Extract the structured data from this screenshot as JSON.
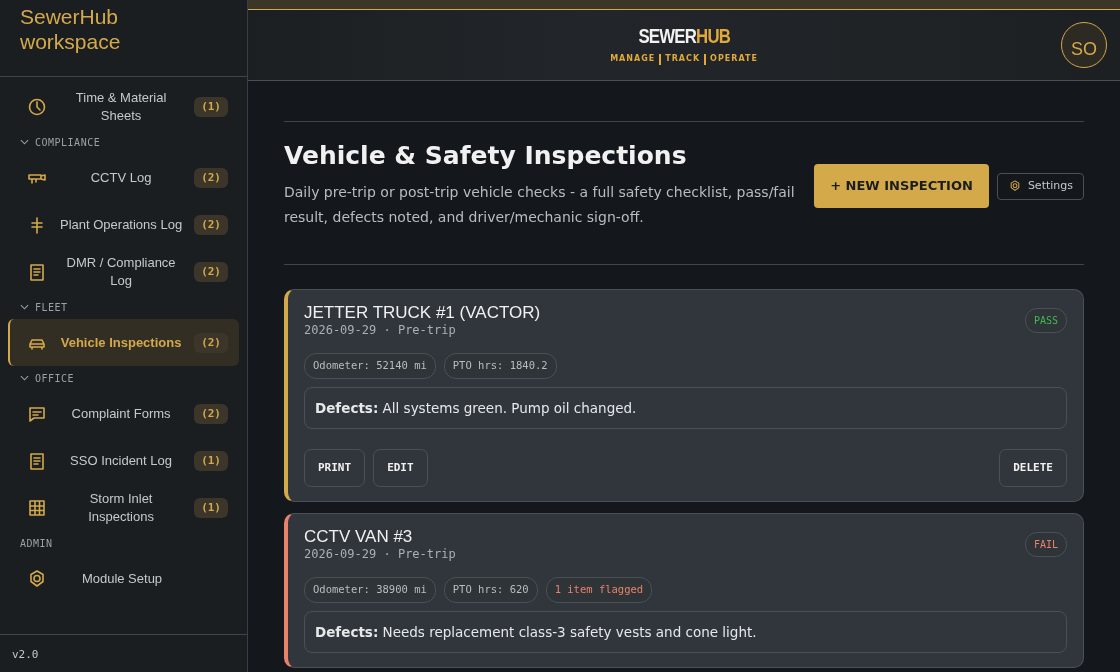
{
  "sidebar": {
    "brand": "SewerHub workspace",
    "sections": [
      {
        "items": [
          {
            "kind": "clock",
            "label": "Time & Material Sheets",
            "count": "(1)",
            "selected": false
          }
        ]
      },
      {
        "heading": "COMPLIANCE",
        "collapsible": true,
        "items": [
          {
            "kind": "camera",
            "label": "CCTV Log",
            "count": "(2)",
            "selected": false
          },
          {
            "kind": "valve",
            "label": "Plant Operations Log",
            "count": "(2)",
            "selected": false
          },
          {
            "kind": "document",
            "label": "DMR / Compliance Log",
            "count": "(2)",
            "selected": false
          }
        ]
      },
      {
        "heading": "FLEET",
        "collapsible": true,
        "items": [
          {
            "kind": "car",
            "label": "Vehicle Inspections",
            "count": "(2)",
            "selected": true
          }
        ]
      },
      {
        "heading": "OFFICE",
        "collapsible": true,
        "items": [
          {
            "kind": "chat",
            "label": "Complaint Forms",
            "count": "(2)",
            "selected": false
          },
          {
            "kind": "document",
            "label": "SSO Incident Log",
            "count": "(1)",
            "selected": false
          },
          {
            "kind": "grid",
            "label": "Storm Inlet Inspections",
            "count": "(1)",
            "selected": false
          }
        ]
      },
      {
        "heading": "ADMIN",
        "collapsible": false,
        "items": [
          {
            "kind": "gear",
            "label": "Module Setup",
            "selected": false
          }
        ]
      }
    ],
    "version": "v2.0"
  },
  "header": {
    "logo": {
      "main": "SEWER",
      "accent": "HUB"
    },
    "tagline": [
      "MANAGE",
      "TRACK",
      "OPERATE"
    ],
    "avatar": "SO"
  },
  "page": {
    "title": "Vehicle & Safety Inspections",
    "description": "Daily pre-trip or post-trip vehicle checks - a full safety checklist, pass/fail result, defects noted, and driver/mechanic sign-off.",
    "primary_button": "+ NEW INSPECTION",
    "settings_button": "Settings"
  },
  "inspections": [
    {
      "title": "JETTER TRUCK #1 (VACTOR)",
      "meta": "2026-09-29 · Pre-trip",
      "kind": "pass",
      "status_label": "PASS",
      "tags": [
        {
          "kind": "plain",
          "text": "Odometer: 52140 mi"
        },
        {
          "kind": "plain",
          "text": "PTO hrs: 1840.2"
        }
      ],
      "defects": "**Defects:** All systems green. Pump oil changed.",
      "actions": [
        "PRINT",
        "EDIT"
      ],
      "danger_action": "DELETE"
    },
    {
      "title": "CCTV VAN #3",
      "meta": "2026-09-29 · Pre-trip",
      "kind": "fail",
      "status_label": "FAIL",
      "tags": [
        {
          "kind": "plain",
          "text": "Odometer: 38900 mi"
        },
        {
          "kind": "plain",
          "text": "PTO hrs: 620"
        },
        {
          "kind": "flagged",
          "text": "1 item flagged"
        }
      ],
      "defects": "**Defects:** Needs replacement class-3 safety vests and cone light."
    }
  ]
}
